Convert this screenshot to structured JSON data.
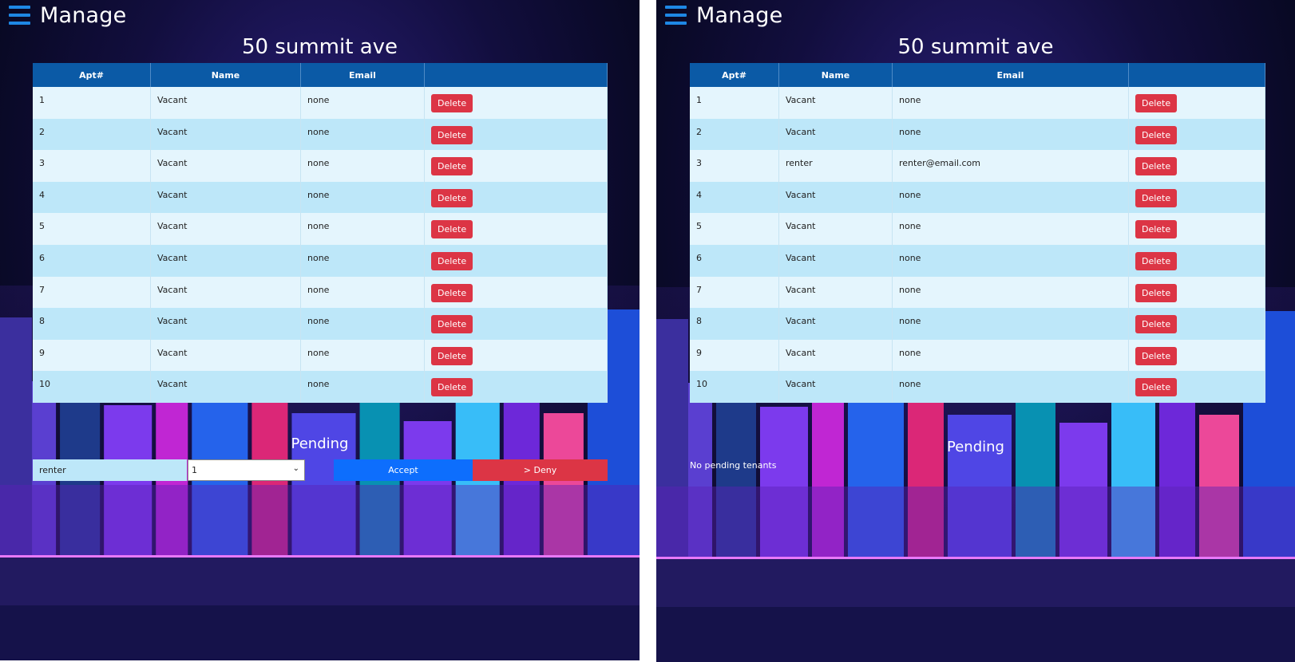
{
  "colors": {
    "header_bg": "#0b5aa6",
    "row_light": "#e4f5fd",
    "row_dark": "#bde7f9",
    "danger": "#dc3545",
    "primary": "#0d6efd",
    "menu_icon": "#1e88e5"
  },
  "left": {
    "header": {
      "menu_icon": "hamburger-menu-icon",
      "title": "Manage"
    },
    "building_title": "50 summit ave",
    "table": {
      "columns": [
        "Apt#",
        "Name",
        "Email",
        ""
      ],
      "delete_label": "Delete",
      "rows": [
        {
          "apt": "1",
          "name": "Vacant",
          "email": "none"
        },
        {
          "apt": "2",
          "name": "Vacant",
          "email": "none"
        },
        {
          "apt": "3",
          "name": "Vacant",
          "email": "none"
        },
        {
          "apt": "4",
          "name": "Vacant",
          "email": "none"
        },
        {
          "apt": "5",
          "name": "Vacant",
          "email": "none"
        },
        {
          "apt": "6",
          "name": "Vacant",
          "email": "none"
        },
        {
          "apt": "7",
          "name": "Vacant",
          "email": "none"
        },
        {
          "apt": "8",
          "name": "Vacant",
          "email": "none"
        },
        {
          "apt": "9",
          "name": "Vacant",
          "email": "none"
        },
        {
          "apt": "10",
          "name": "Vacant",
          "email": "none"
        }
      ]
    },
    "pending": {
      "title": "Pending",
      "tenant_name": "renter",
      "apt_select_value": "1",
      "accept_label": "Accept",
      "deny_label": "> Deny"
    }
  },
  "right": {
    "header": {
      "menu_icon": "hamburger-menu-icon",
      "title": "Manage"
    },
    "building_title": "50 summit ave",
    "table": {
      "columns": [
        "Apt#",
        "Name",
        "Email",
        ""
      ],
      "delete_label": "Delete",
      "rows": [
        {
          "apt": "1",
          "name": "Vacant",
          "email": "none"
        },
        {
          "apt": "2",
          "name": "Vacant",
          "email": "none"
        },
        {
          "apt": "3",
          "name": "renter",
          "email": "renter@email.com"
        },
        {
          "apt": "4",
          "name": "Vacant",
          "email": "none"
        },
        {
          "apt": "5",
          "name": "Vacant",
          "email": "none"
        },
        {
          "apt": "6",
          "name": "Vacant",
          "email": "none"
        },
        {
          "apt": "7",
          "name": "Vacant",
          "email": "none"
        },
        {
          "apt": "8",
          "name": "Vacant",
          "email": "none"
        },
        {
          "apt": "9",
          "name": "Vacant",
          "email": "none"
        },
        {
          "apt": "10",
          "name": "Vacant",
          "email": "none"
        }
      ]
    },
    "pending": {
      "title": "Pending",
      "empty_message": "No pending tenants"
    }
  }
}
